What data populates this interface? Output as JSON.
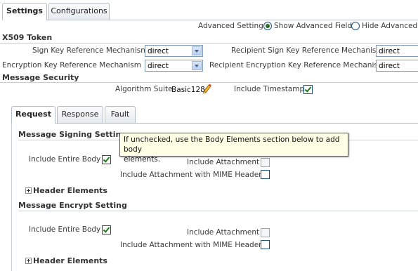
{
  "top_tabs": [
    {
      "label": "Settings",
      "active": true
    },
    {
      "label": "Configurations",
      "active": false
    }
  ],
  "advanced": {
    "label": "Advanced Setting",
    "show_label": "Show Advanced Fields",
    "hide_label": "Hide Advanced F"
  },
  "x509": {
    "title": "X509 Token",
    "sign_key_label": "Sign Key Reference Mechanism",
    "sign_key_value": "direct",
    "recipient_sign_label": "Recipient Sign Key Reference Mechanism",
    "recipient_sign_value": "direct",
    "enc_key_label": "Encryption Key Reference Mechanism",
    "enc_key_value": "direct",
    "recipient_enc_label": "Recipient Encryption Key Reference Mechanism",
    "recipient_enc_value": "direct"
  },
  "message_security": {
    "title": "Message Security",
    "algorithm_label": "Algorithm Suite",
    "algorithm_value": "Basic128",
    "timestamp_label": "Include Timestamp",
    "timestamp_checked": true
  },
  "inner_tabs": [
    {
      "label": "Request",
      "active": true
    },
    {
      "label": "Response",
      "active": false
    },
    {
      "label": "Fault",
      "active": false
    }
  ],
  "signing": {
    "title": "Message Signing Setting",
    "include_body_label": "Include Entire Body",
    "include_body_checked": true,
    "include_attachment_label": "Include Attachment",
    "include_mime_label": "Include Attachment with MIME Headers",
    "header_elements_label": "Header Elements"
  },
  "tooltip": {
    "line1": "If unchecked, use the Body Elements section below to add body",
    "line2": "elements."
  },
  "encrypt": {
    "title": "Message Encrypt Setting",
    "include_body_label": "Include Entire Body",
    "include_body_checked": true,
    "include_attachment_label": "Include Attachment",
    "include_mime_label": "Include Attachment with MIME Headers",
    "header_elements_label": "Header Elements"
  },
  "colors": {
    "border": "#b5bcc7",
    "check": "#1f7a1f",
    "tooltip_bg": "#ffffe6"
  },
  "icons": {
    "edit": "pencil-icon",
    "expand": "plus-box-icon"
  }
}
